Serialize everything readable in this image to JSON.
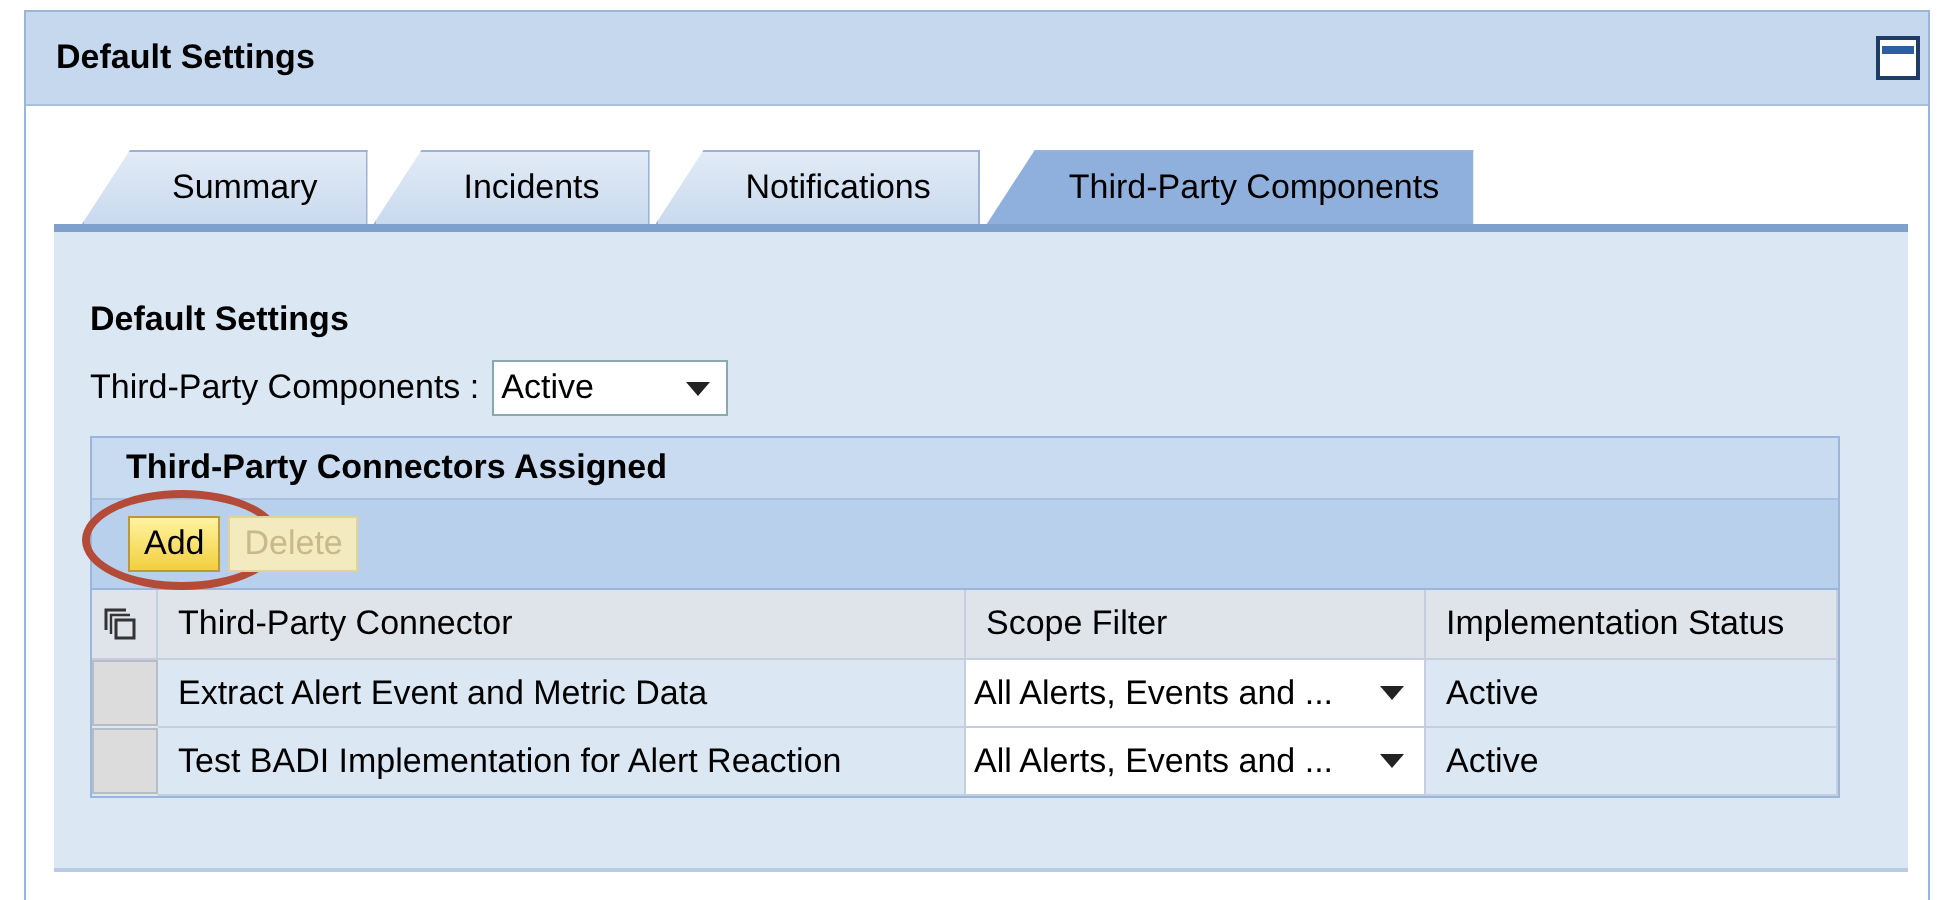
{
  "panel": {
    "title": "Default Settings"
  },
  "tabs": [
    {
      "label": "Summary",
      "selected": false
    },
    {
      "label": "Incidents",
      "selected": false
    },
    {
      "label": "Notifications",
      "selected": false
    },
    {
      "label": "Third-Party Components",
      "selected": true
    }
  ],
  "section": {
    "title": "Default Settings",
    "field_label": "Third-Party Components :",
    "field_value": "Active"
  },
  "table": {
    "title": "Third-Party Connectors Assigned",
    "buttons": [
      {
        "label": "Add",
        "disabled": false,
        "highlighted": true
      },
      {
        "label": "Delete",
        "disabled": true,
        "highlighted": false
      }
    ],
    "columns": [
      "Third-Party Connector",
      "Scope Filter",
      "Implementation Status"
    ],
    "rows": [
      {
        "connector": "Extract Alert Event and Metric Data",
        "scope": "All Alerts, Events and ...",
        "status": "Active"
      },
      {
        "connector": "Test BADI Implementation for Alert Reaction",
        "scope": "All Alerts, Events and ...",
        "status": "Active"
      }
    ]
  }
}
